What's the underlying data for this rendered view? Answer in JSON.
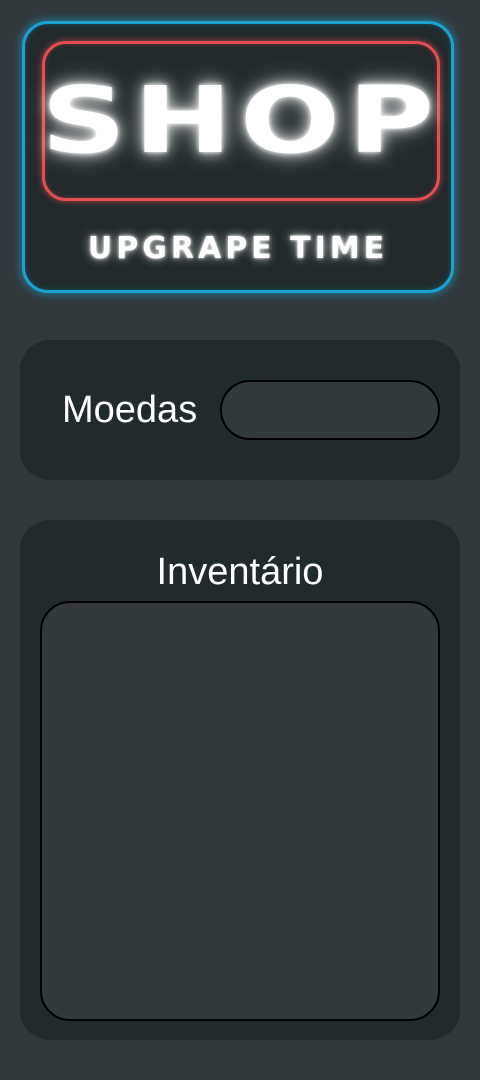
{
  "header": {
    "title": "SHOP",
    "subtitle": "UPGRAPE TIME"
  },
  "coins": {
    "label": "Moedas",
    "value": ""
  },
  "inventory": {
    "title": "Inventário",
    "items": []
  },
  "colors": {
    "background": "#32393c",
    "panel": "#212a2c",
    "neon_blue": "#1aa3cf",
    "neon_red": "#e24e53",
    "text": "#ffffff"
  }
}
